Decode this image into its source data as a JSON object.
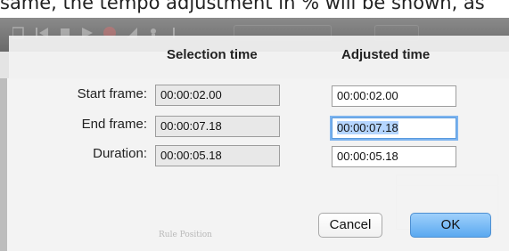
{
  "background": {
    "document_text": "same, the tempo adjustment in % will be shown, as",
    "faded_caption": "Rule Position"
  },
  "dialog": {
    "columns": {
      "selection": "Selection time",
      "adjusted": "Adjusted time"
    },
    "rows": [
      {
        "label": "Start frame:",
        "selection": "00:00:02.00",
        "adjusted": "00:00:02.00"
      },
      {
        "label": "End frame:",
        "selection": "00:00:07.18",
        "adjusted": "00:00:07.18"
      },
      {
        "label": "Duration:",
        "selection": "00:00:05.18",
        "adjusted": "00:00:05.18"
      }
    ],
    "buttons": {
      "cancel": "Cancel",
      "ok": "OK"
    },
    "focused_field": "end-frame-adjusted"
  },
  "colors": {
    "focus_ring": "#7db4ef",
    "ok_button": "#5aa9f0",
    "text_selection": "#b5d5ff"
  }
}
